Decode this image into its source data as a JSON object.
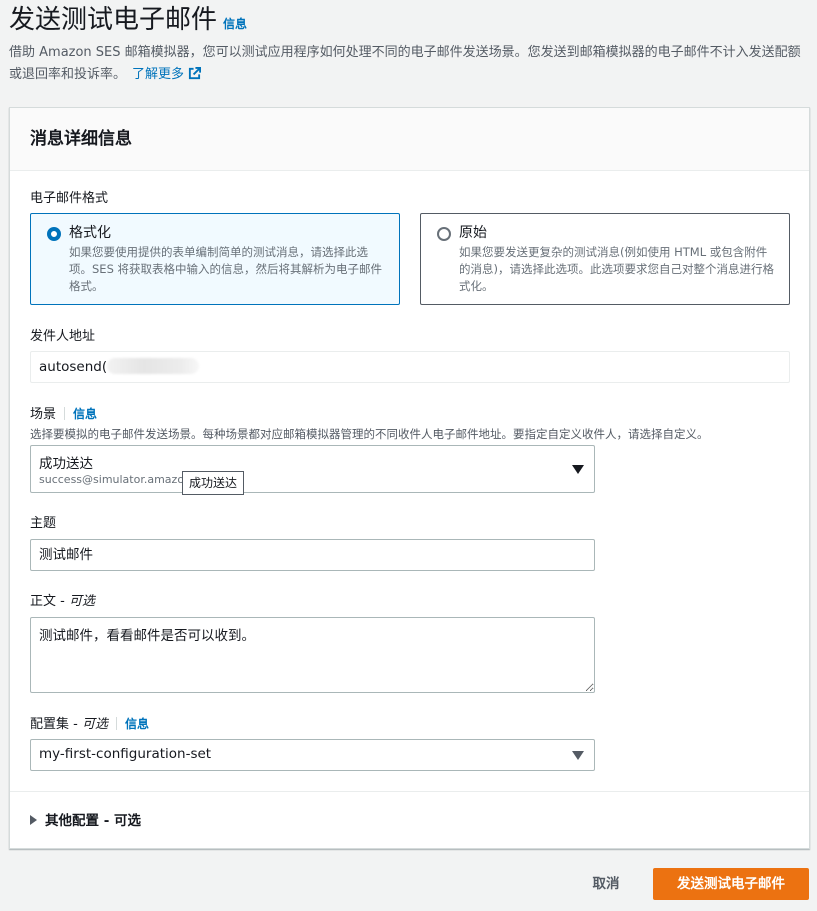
{
  "header": {
    "title": "发送测试电子邮件",
    "info_link": "信息",
    "description": "借助 Amazon SES 邮箱模拟器，您可以测试应用程序如何处理不同的电子邮件发送场景。您发送到邮箱模拟器的电子邮件不计入发送配额或退回率和投诉率。",
    "learn_more": "了解更多"
  },
  "panel": {
    "title": "消息详细信息",
    "email_format": {
      "label": "电子邮件格式",
      "options": [
        {
          "title": "格式化",
          "description": "如果您要使用提供的表单编制简单的测试消息，请选择此选项。SES 将获取表格中输入的信息，然后将其解析为电子邮件格式。",
          "selected": true
        },
        {
          "title": "原始",
          "description": "如果您要发送更复杂的测试消息(例如使用 HTML 或包含附件的消息)，请选择此选项。此选项要求您自己对整个消息进行格式化。",
          "selected": false
        }
      ]
    },
    "from_address": {
      "label": "发件人地址",
      "value": "autosend("
    },
    "scenario": {
      "label": "场景",
      "info": "信息",
      "description": "选择要模拟的电子邮件发送场景。每种场景都对应邮箱模拟器管理的不同收件人电子邮件地址。要指定自定义收件人，请选择自定义。",
      "selected_label": "成功送达",
      "selected_sub": "success@simulator.amazon",
      "tooltip": "成功送达"
    },
    "subject": {
      "label": "主题",
      "value": "测试邮件"
    },
    "body": {
      "label": "正文",
      "optional": "可选",
      "value": "测试邮件，看看邮件是否可以收到。"
    },
    "config_set": {
      "label": "配置集",
      "optional": "可选",
      "info": "信息",
      "value": "my-first-configuration-set"
    },
    "other_config": {
      "label": "其他配置 - 可选"
    }
  },
  "footer": {
    "cancel": "取消",
    "send": "发送测试电子邮件"
  },
  "colors": {
    "link": "#0073bb",
    "primary_button": "#ec7211",
    "selected_tile_bg": "#f1faff"
  }
}
